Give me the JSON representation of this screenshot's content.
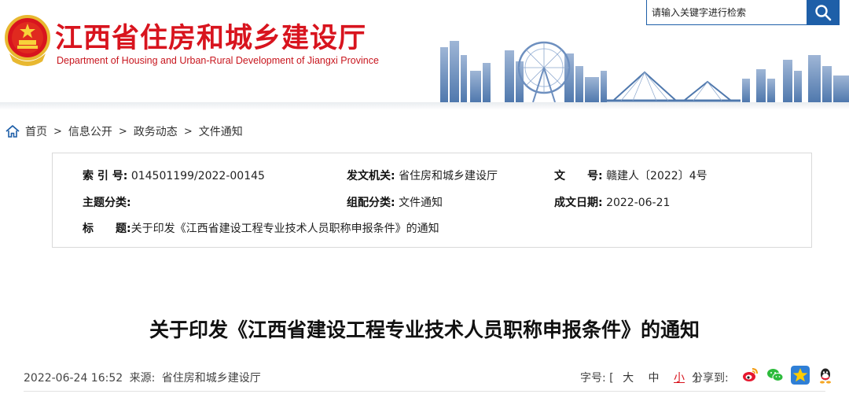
{
  "header": {
    "title": "江西省住房和城乡建设厅",
    "subtitle": "Department of Housing and Urban-Rural Development of Jiangxi Province",
    "search_placeholder": "请输入关键字进行检索",
    "colors": {
      "brand_red": "#d8141e",
      "search_blue": "#1e5fa8"
    }
  },
  "breadcrumb": {
    "items": [
      "首页",
      "信息公开",
      "政务动态",
      "文件通知"
    ],
    "separator": ">"
  },
  "info": {
    "index_label": "索 引 号:",
    "index_value": "014501199/2022-00145",
    "issuer_label": "发文机关:",
    "issuer_value": "省住房和城乡建设厅",
    "docno_label": "文　　号:",
    "docno_value": "赣建人〔2022〕4号",
    "topic_label": "主题分类:",
    "topic_value": "",
    "category_label": "组配分类:",
    "category_value": "文件通知",
    "date_label": "成文日期:",
    "date_value": "2022-06-21",
    "title_label": "标　　题:",
    "title_value": "关于印发《江西省建设工程专业技术人员职称申报条件》的通知"
  },
  "article": {
    "title": "关于印发《江西省建设工程专业技术人员职称申报条件》的通知",
    "published": "2022-06-24 16:52",
    "source_label": "来源:",
    "source_value": "省住房和城乡建设厅"
  },
  "font_size": {
    "label": "字号:",
    "open_bracket": "[",
    "close_bracket": "]",
    "options": [
      "大",
      "中",
      "小"
    ],
    "active": "小"
  },
  "share": {
    "label": "分享到:",
    "icons": [
      "weibo-icon",
      "wechat-icon",
      "qzone-icon",
      "qq-icon"
    ]
  }
}
